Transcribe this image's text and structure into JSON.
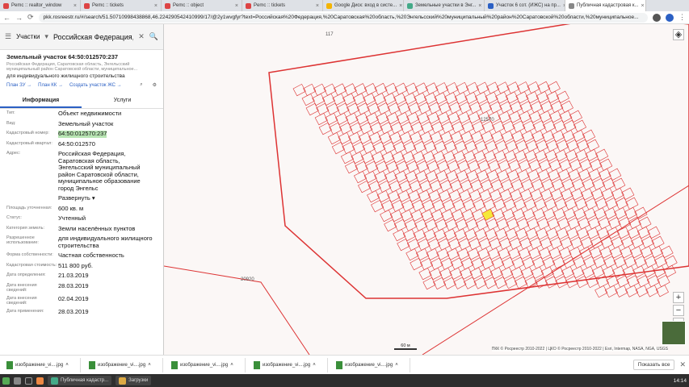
{
  "browser": {
    "tabs": [
      {
        "label": "Pemc :: realtor_window",
        "color": "#d44"
      },
      {
        "label": "Pemc :: tickets",
        "color": "#d44"
      },
      {
        "label": "Pemc :: object",
        "color": "#d44"
      },
      {
        "label": "Pemc :: tickets",
        "color": "#d44"
      },
      {
        "label": "Google Диск: вход в систе...",
        "color": "#f4b400"
      },
      {
        "label": "Земельные участки в Энг...",
        "color": "#4a8"
      },
      {
        "label": "Участок 6 сот. (ИЖС) на пр...",
        "color": "#2b60c4"
      },
      {
        "label": "Публичная кадастровая к...",
        "color": "#888"
      }
    ],
    "url": "pkk.rosreestr.ru/#/search/51.50710998438868,46.224290542410999/17/@2y1wvgfyr?text=Российская%20Федерация,%20Саратовская%20область,%20Энгельсский%20муниципальный%20район%20Саратовской%20области,%20муниципальное..."
  },
  "panel": {
    "search_type": "Участки",
    "search_query": "Российская Федерация, Са",
    "title": "Земельный участок 64:50:012570:237",
    "address_small": "Российская Федерация, Саратовская область, Энгельсский муниципальный район Саратовской области, муниципальное...",
    "purpose": "для индивидуального жилищного строительства",
    "links": [
      "План ЗУ →",
      "План КК →",
      "Создать участок ЖС →"
    ],
    "tab_info": "Информация",
    "tab_services": "Услуги",
    "fields": [
      {
        "k": "Тип:",
        "v": "Объект недвижимости"
      },
      {
        "k": "Вид:",
        "v": "Земельный участок"
      },
      {
        "k": "Кадастровый номер:",
        "v": "64:50:012570:237",
        "hl": true
      },
      {
        "k": "Кадастровый квартал:",
        "v": "64:50:012570",
        "link": true
      },
      {
        "k": "Адрес:",
        "v": "Российская Федерация, Саратовская область, Энгельсский муниципальный район Саратовской области, муниципальное образование город Энгельс"
      },
      {
        "k": "",
        "v": "Развернуть ▾",
        "link": true
      },
      {
        "k": "Площадь уточненная:",
        "v": "600 кв. м"
      },
      {
        "k": "Статус:",
        "v": "Учтенный"
      },
      {
        "k": "Категория земель:",
        "v": "Земли населённых пунктов"
      },
      {
        "k": "Разрешенное использование:",
        "v": "для индивидуального жилищного строительства"
      },
      {
        "k": "Форма собственности:",
        "v": "Частная собственность"
      },
      {
        "k": "Кадастровая стоимость:",
        "v": "511 800 руб."
      },
      {
        "k": "Дата определения:",
        "v": "21.03.2019"
      },
      {
        "k": "Дата внесения сведений:",
        "v": "28.03.2019"
      },
      {
        "k": "Дата внесения сведений:",
        "v": "02.04.2019"
      },
      {
        "k": "Дата применения:",
        "v": "28.03.2019"
      }
    ]
  },
  "map": {
    "labels": [
      "117",
      "20920",
      "12570",
      "60 м"
    ],
    "copyright": "ПКК © Росреестр 2010-2022 | ЦКО © Росреестр 2010-2022 | Esri, Intermap, NASA, NGA, USGS",
    "show_all": "Показать все",
    "colors": {
      "parcel": "#d33",
      "selected": "#f5e83a"
    }
  },
  "downloads": [
    "изображение_vi....jpg",
    "изображение_vi....jpg",
    "изображение_vi....jpg",
    "изображение_vi....jpg",
    "изображение_vi....jpg"
  ],
  "taskbar": {
    "items": [
      "Публичная кадастр...",
      "Загрузки"
    ],
    "clock": "14:14"
  }
}
